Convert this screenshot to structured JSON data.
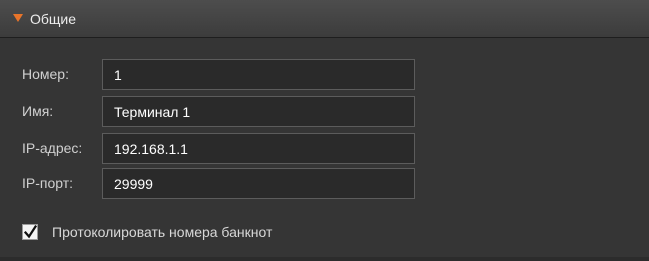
{
  "section": {
    "title": "Общие",
    "expanded": true,
    "arrow_color": "#e8742a",
    "expand_icon": "triangle-down-icon"
  },
  "fields": [
    {
      "label": "Номер:",
      "value": "1"
    },
    {
      "label": "Имя:",
      "value": "Терминал 1"
    },
    {
      "label": "IP-адрес:",
      "value": "192.168.1.1"
    },
    {
      "label": "IP-порт:",
      "value": "29999"
    }
  ],
  "options": {
    "log_banknotes": {
      "label": "Протоколировать номера банкнот",
      "checked": true
    }
  }
}
